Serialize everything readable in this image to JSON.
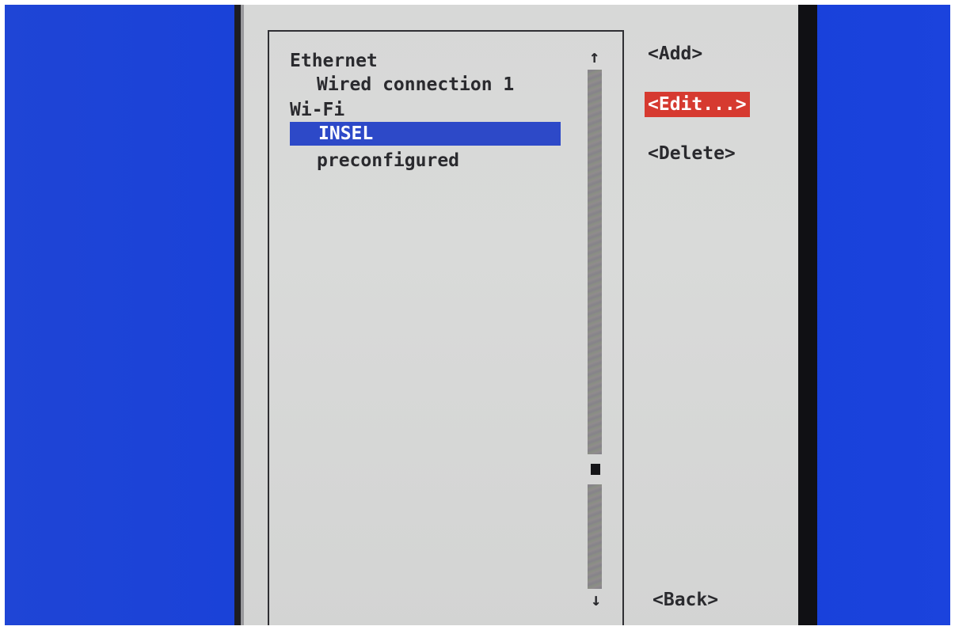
{
  "connections": {
    "items": [
      {
        "label": "Ethernet",
        "type": "group"
      },
      {
        "label": "Wired connection 1",
        "type": "connection"
      },
      {
        "label": "Wi-Fi",
        "type": "group"
      },
      {
        "label": "INSEL",
        "type": "connection",
        "selected": true
      },
      {
        "label": "preconfigured",
        "type": "connection"
      }
    ]
  },
  "scrollbar": {
    "up_arrow": "↑",
    "down_arrow": "↓",
    "up_icon": "arrow-up-icon",
    "down_icon": "arrow-down-icon"
  },
  "buttons": {
    "add": "<Add>",
    "edit": "<Edit...>",
    "delete": "<Delete>",
    "back": "<Back>",
    "focused": "edit"
  },
  "colors": {
    "screen_background": "#1740d9",
    "dialog_background": "#d8d9d8",
    "selection_highlight": "#2d49c8",
    "focused_button": "#d63a30"
  }
}
